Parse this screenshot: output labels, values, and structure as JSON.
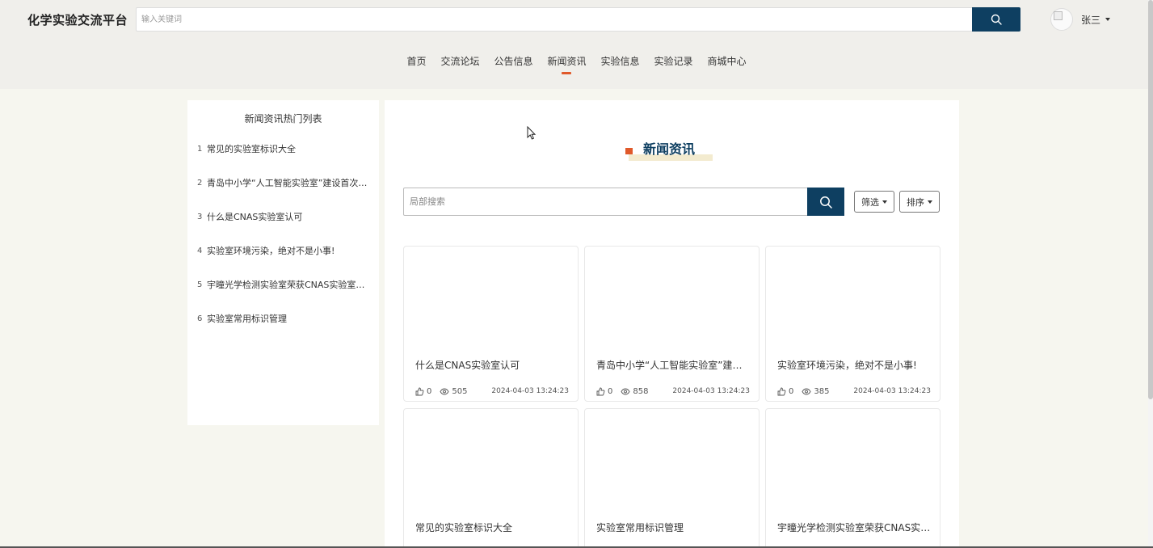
{
  "header": {
    "brand": "化学实验交流平台",
    "search_placeholder": "输入关键词",
    "user_name": "张三"
  },
  "nav": {
    "items": [
      {
        "label": "首页",
        "active": false
      },
      {
        "label": "交流论坛",
        "active": false
      },
      {
        "label": "公告信息",
        "active": false
      },
      {
        "label": "新闻资讯",
        "active": true
      },
      {
        "label": "实验信息",
        "active": false
      },
      {
        "label": "实验记录",
        "active": false
      },
      {
        "label": "商城中心",
        "active": false
      }
    ]
  },
  "sidebar": {
    "title": "新闻资讯热门列表",
    "items": [
      {
        "num": "1",
        "text": "常见的实验室标识大全"
      },
      {
        "num": "2",
        "text": "青岛中小学“人工智能实验室”建设首次启动"
      },
      {
        "num": "3",
        "text": "什么是CNAS实验室认可"
      },
      {
        "num": "4",
        "text": "实验室环境污染，绝对不是小事!"
      },
      {
        "num": "5",
        "text": "宇曈光学检测实验室荣获CNAS实验室认可证书"
      },
      {
        "num": "6",
        "text": "实验室常用标识管理"
      }
    ]
  },
  "main": {
    "section_title": "新闻资讯",
    "search_placeholder": "局部搜索",
    "filter_label": "筛选",
    "sort_label": "排序",
    "cards": [
      {
        "title": "什么是CNAS实验室认可",
        "likes": "0",
        "views": "505",
        "date": "2024-04-03 13:24:23"
      },
      {
        "title": "青岛中小学“人工智能实验室”建设首次启动",
        "likes": "0",
        "views": "858",
        "date": "2024-04-03 13:24:23"
      },
      {
        "title": "实验室环境污染，绝对不是小事!",
        "likes": "0",
        "views": "385",
        "date": "2024-04-03 13:24:23"
      },
      {
        "title": "常见的实验室标识大全",
        "likes": "",
        "views": "",
        "date": ""
      },
      {
        "title": "实验室常用标识管理",
        "likes": "",
        "views": "",
        "date": ""
      },
      {
        "title": "宇曈光学检测实验室荣获CNAS实验室认可证书",
        "likes": "",
        "views": "",
        "date": ""
      }
    ]
  },
  "colors": {
    "primary": "#0e3f61",
    "accent": "#e0592a",
    "background": "#f6f6ef"
  }
}
